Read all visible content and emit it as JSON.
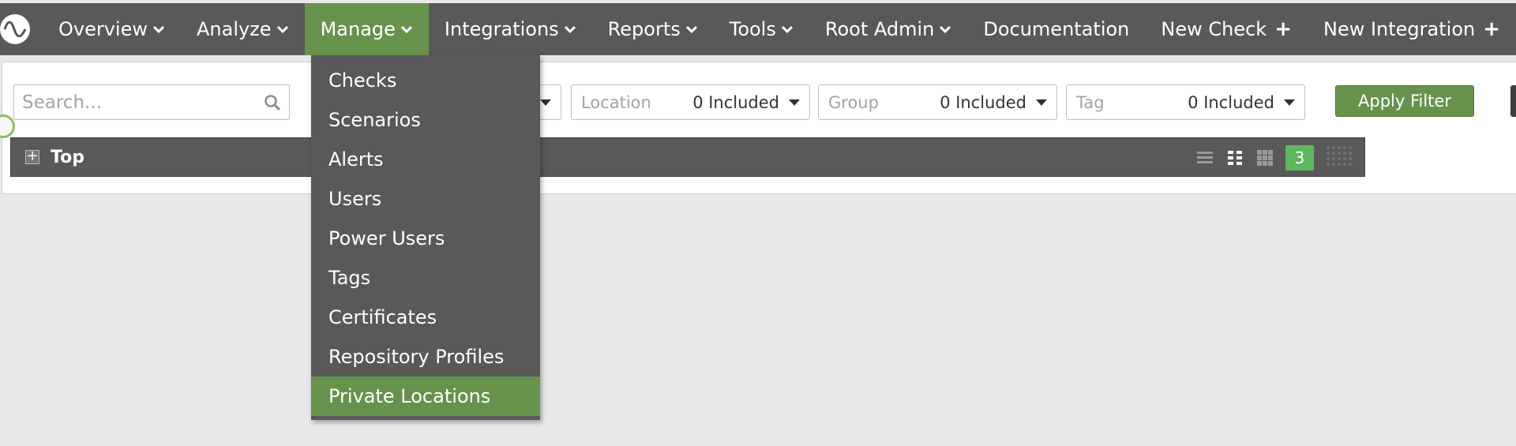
{
  "nav": {
    "logo_icon": "waveform-logo-icon",
    "items": [
      {
        "label": "Overview",
        "icon": "chevron-down-icon"
      },
      {
        "label": "Analyze",
        "icon": "chevron-down-icon"
      },
      {
        "label": "Manage",
        "icon": "chevron-down-icon",
        "active": true
      },
      {
        "label": "Integrations",
        "icon": "chevron-down-icon"
      },
      {
        "label": "Reports",
        "icon": "chevron-down-icon"
      },
      {
        "label": "Tools",
        "icon": "chevron-down-icon"
      },
      {
        "label": "Root Admin",
        "icon": "chevron-down-icon"
      },
      {
        "label": "Documentation"
      },
      {
        "label": "New Check",
        "suffix": "+"
      },
      {
        "label": "New Integration",
        "suffix": "+"
      }
    ]
  },
  "manage_menu": {
    "items": [
      {
        "label": "Checks"
      },
      {
        "label": "Scenarios"
      },
      {
        "label": "Alerts"
      },
      {
        "label": "Users"
      },
      {
        "label": "Power Users"
      },
      {
        "label": "Tags"
      },
      {
        "label": "Certificates"
      },
      {
        "label": "Repository Profiles"
      },
      {
        "label": "Private Locations",
        "highlighted": true
      }
    ]
  },
  "filters": {
    "search_placeholder": "Search...",
    "location": {
      "label": "Location",
      "value": "0 Included"
    },
    "group": {
      "label": "Group",
      "value": "0 Included"
    },
    "tag": {
      "label": "Tag",
      "value": "0 Included"
    },
    "apply_label": "Apply Filter"
  },
  "top_section": {
    "expand_symbol": "+",
    "title": "Top",
    "column_count": "3"
  },
  "colors": {
    "nav_bg": "#595959",
    "accent_green": "#67924c",
    "badge_green": "#5cb85c",
    "page_bg": "#e9e9e9"
  }
}
